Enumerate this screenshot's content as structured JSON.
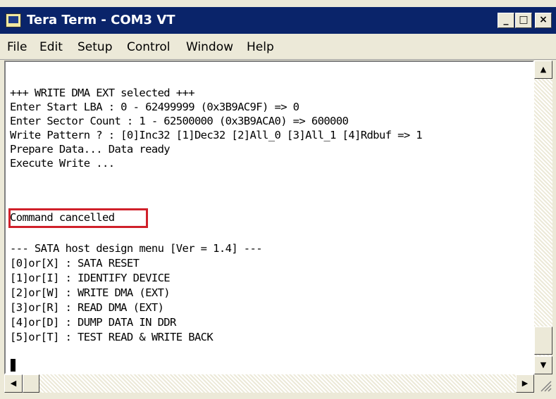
{
  "window": {
    "title": "Tera Term - COM3 VT",
    "minimize_icon": "minimize-icon",
    "maximize_icon": "maximize-icon",
    "close_icon": "close-icon"
  },
  "menu": {
    "items": [
      "File",
      "Edit",
      "Setup",
      "Control",
      "Window",
      "Help"
    ]
  },
  "terminal": {
    "lines": [
      "+++ WRITE DMA EXT selected +++",
      "Enter Start LBA : 0 - 62499999 (0x3B9AC9F) => 0",
      "Enter Sector Count : 1 - 62500000 (0x3B9ACA0) => 600000",
      "Write Pattern ? : [0]Inc32 [1]Dec32 [2]All_0 [3]All_1 [4]Rdbuf => 1",
      "Prepare Data... Data ready",
      "Execute Write ...",
      "",
      "Command cancelled",
      "",
      "--- SATA host design menu [Ver = 1.4] ---",
      "[0]or[X] : SATA RESET",
      "[1]or[I] : IDENTIFY DEVICE",
      "[2]or[W] : WRITE DMA (EXT)",
      "[3]or[R] : READ DMA (EXT)",
      "[4]or[D] : DUMP DATA IN DDR",
      "[5]or[T] : TEST READ & WRITE BACK"
    ],
    "highlight_color": "#d0202a"
  },
  "scrollbars": {
    "up_arrow": "▲",
    "down_arrow": "▼",
    "left_arrow": "◀",
    "right_arrow": "▶"
  }
}
